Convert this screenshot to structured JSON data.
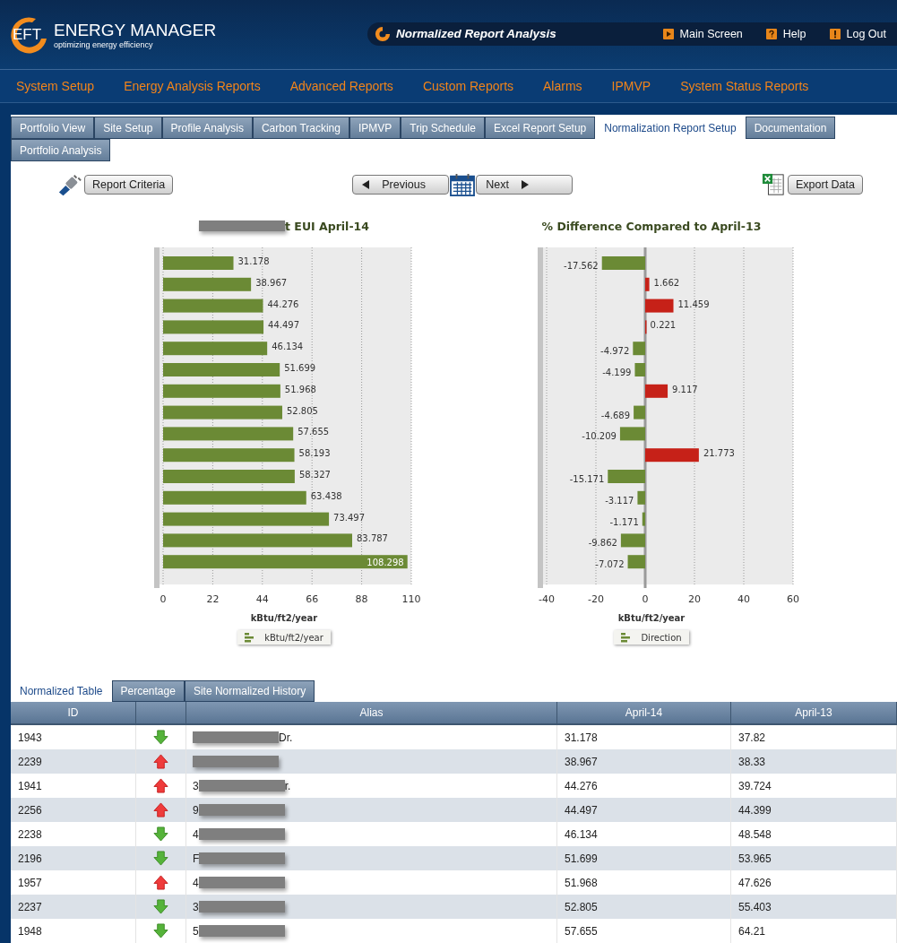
{
  "header": {
    "logo_mark": "EFT",
    "logo_title": "ENERGY MANAGER",
    "logo_tagline": "optimizing energy efficiency",
    "screen_title": "Normalized Report Analysis",
    "links": [
      {
        "kind": "main",
        "label": "Main Screen"
      },
      {
        "kind": "help",
        "label": "Help"
      },
      {
        "kind": "logout",
        "label": "Log Out"
      }
    ]
  },
  "menu": [
    "System Setup",
    "Energy Analysis Reports",
    "Advanced Reports",
    "Custom Reports",
    "Alarms",
    "IPMVP",
    "System Status Reports"
  ],
  "tabs": [
    {
      "label": "Portfolio View",
      "selected": false
    },
    {
      "label": "Site Setup",
      "selected": false
    },
    {
      "label": "Profile Analysis",
      "selected": false
    },
    {
      "label": "Carbon Tracking",
      "selected": false
    },
    {
      "label": "IPMVP",
      "selected": false
    },
    {
      "label": "Trip Schedule",
      "selected": false
    },
    {
      "label": "Excel Report Setup",
      "selected": false
    },
    {
      "label": "Normalization Report Setup",
      "selected": true
    },
    {
      "label": "Documentation",
      "selected": false
    },
    {
      "label": "Portfolio Analysis",
      "selected": false
    }
  ],
  "toolbar": {
    "criteria": "Report Criteria",
    "previous": "Previous",
    "next": "Next",
    "export": "Export Data"
  },
  "charts": [
    {
      "title": "t EUI  April-14",
      "title_redacted": true,
      "chart_data": {
        "type": "bar",
        "orientation": "horizontal",
        "xlabel": "kBtu/ft2/year",
        "xlim": [
          0,
          110
        ],
        "xticks": [
          0,
          22,
          44,
          66,
          88,
          110
        ],
        "grid": true,
        "data_labels": true,
        "series": [
          {
            "name": "kBtu/ft2/year",
            "color": "#6b8a35",
            "values": [
              31.178,
              38.967,
              44.276,
              44.497,
              46.134,
              51.699,
              51.968,
              52.805,
              57.655,
              58.193,
              58.327,
              63.438,
              73.497,
              83.787,
              108.298
            ]
          }
        ]
      }
    },
    {
      "title": "% Difference Compared to  April-13",
      "title_redacted": false,
      "chart_data": {
        "type": "bar",
        "orientation": "horizontal",
        "xlabel": "kBtu/ft2/year",
        "xlim": [
          -40,
          60
        ],
        "xticks": [
          -40,
          -20,
          0,
          20,
          40,
          60
        ],
        "grid": true,
        "data_labels": true,
        "series": [
          {
            "name": "Direction",
            "color": "#6b8a35",
            "colors": [
              "#6b8a35",
              "#c62118",
              "#c62118",
              "#c62118",
              "#6b8a35",
              "#6b8a35",
              "#c62118",
              "#6b8a35",
              "#6b8a35",
              "#c62118",
              "#6b8a35",
              "#6b8a35",
              "#6b8a35",
              "#6b8a35",
              "#6b8a35"
            ],
            "values": [
              -17.562,
              1.662,
              11.459,
              0.221,
              -4.972,
              -4.199,
              9.117,
              -4.689,
              -10.209,
              21.773,
              -15.171,
              -3.117,
              -1.171,
              -9.862,
              -7.072
            ]
          }
        ]
      }
    }
  ],
  "table_tabs": [
    {
      "label": "Normalized Table",
      "selected": true
    },
    {
      "label": "Percentage",
      "selected": false
    },
    {
      "label": "Site Normalized History",
      "selected": false
    }
  ],
  "table": {
    "columns": [
      "ID",
      "Alias",
      "April-14",
      "April-13"
    ],
    "rows": [
      {
        "id": "1943",
        "kind": "down",
        "alias_end": "Dr.",
        "redacted": true,
        "april_14": "31.178",
        "april_13": "37.82"
      },
      {
        "id": "2239",
        "kind": "up",
        "redacted": true,
        "april_14": "38.967",
        "april_13": "38.33"
      },
      {
        "id": "1941",
        "kind": "up",
        "alias_start": "3",
        "alias_end": "r.",
        "redacted": true,
        "april_14": "44.276",
        "april_13": "39.724"
      },
      {
        "id": "2256",
        "kind": "up",
        "alias_start": "9",
        "redacted": true,
        "april_14": "44.497",
        "april_13": "44.399"
      },
      {
        "id": "2238",
        "kind": "down",
        "alias_start": "4",
        "redacted": true,
        "april_14": "46.134",
        "april_13": "48.548"
      },
      {
        "id": "2196",
        "kind": "down",
        "alias_start": "F",
        "redacted": true,
        "april_14": "51.699",
        "april_13": "53.965"
      },
      {
        "id": "1957",
        "kind": "up",
        "alias_start": "4",
        "redacted": true,
        "april_14": "51.968",
        "april_13": "47.626"
      },
      {
        "id": "2237",
        "kind": "down",
        "alias_start": "3",
        "redacted": true,
        "april_14": "52.805",
        "april_13": "55.403"
      },
      {
        "id": "1948",
        "kind": "down",
        "alias_start": "5",
        "redacted": true,
        "april_14": "57.655",
        "april_13": "64.21"
      }
    ]
  }
}
